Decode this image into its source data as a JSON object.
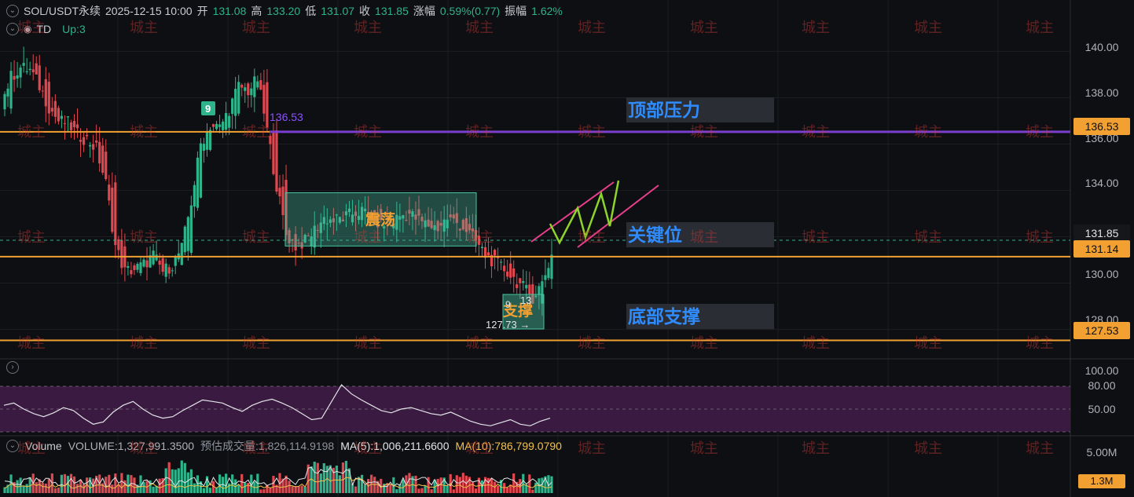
{
  "header": {
    "symbol": "SOL/USDT永续",
    "datetime": "2025-12-15 10:00",
    "open_label": "开",
    "open": "131.08",
    "high_label": "高",
    "high": "133.20",
    "low_label": "低",
    "low": "131.07",
    "close_label": "收",
    "close": "131.85",
    "change_label": "涨幅",
    "change": "0.59%(0.77)",
    "amplitude_label": "振幅",
    "amplitude": "1.62%"
  },
  "indicator": {
    "name": "TD",
    "status": "Up:3"
  },
  "volume_legend": {
    "title": "Volume",
    "volume": "VOLUME:1,327,991.3500",
    "estimated": "预估成交量:1,826,114.9198",
    "ma5": "MA(5):1,006,211.6600",
    "ma10": "MA(10):786,799.0790"
  },
  "price_axis": [
    "140.00",
    "138.00",
    "136.00",
    "134.00",
    "130.00",
    "128.00"
  ],
  "price_tags": {
    "top": "136.53",
    "current": "131.85",
    "key": "131.14",
    "support": "127.53"
  },
  "rsi_axis": [
    "100.00",
    "80.00",
    "50.00"
  ],
  "volume_axis": {
    "max": "5.00M",
    "current": "1.3M"
  },
  "annotations": {
    "top_pressure": "顶部压力",
    "key_level": "关键位",
    "bottom_support": "底部支撑",
    "range_box": "震荡",
    "support_box": "支撑",
    "line_value": "136.53",
    "low_marker": "127.73 →",
    "td_9_a": "9",
    "td_9_b": "9",
    "td_13": "13"
  },
  "watermark": "城主",
  "colors": {
    "background": "#0e0f12",
    "up": "#2fb38a",
    "down": "#e0474f",
    "orange_line": "#f2a032",
    "purple_line": "#7b3fd0",
    "label_blue": "#2f8cff",
    "rsi_fill": "#3a1a40"
  },
  "chart_data": {
    "type": "candlestick",
    "y_range": [
      126.8,
      141.2
    ],
    "horizontal_levels": [
      136.53,
      131.85,
      131.14,
      127.53
    ],
    "range_box": [
      131.6,
      133.9
    ],
    "rsi_range": [
      0,
      100
    ],
    "rsi_levels": [
      80,
      50,
      20
    ],
    "closes": [
      138.9,
      139.3,
      139.2,
      138.5,
      137.6,
      137.0,
      136.9,
      136.4,
      136.2,
      135.8,
      134.3,
      131.6,
      130.5,
      130.6,
      130.8,
      131.2,
      130.5,
      130.8,
      131.5,
      133.5,
      136.0,
      136.8,
      136.7,
      137.5,
      138.5,
      138.3,
      138.8,
      136.6,
      134.2,
      132.1,
      131.6,
      131.8,
      132.3,
      132.8,
      132.7,
      132.8,
      133.0,
      133.1,
      132.9,
      132.5,
      132.6,
      132.9,
      133.0,
      132.7,
      132.5,
      132.4,
      132.8,
      132.6,
      132.3,
      131.8,
      131.2,
      130.9,
      130.6,
      130.2,
      129.8,
      129.4,
      130.0,
      131.2
    ]
  }
}
